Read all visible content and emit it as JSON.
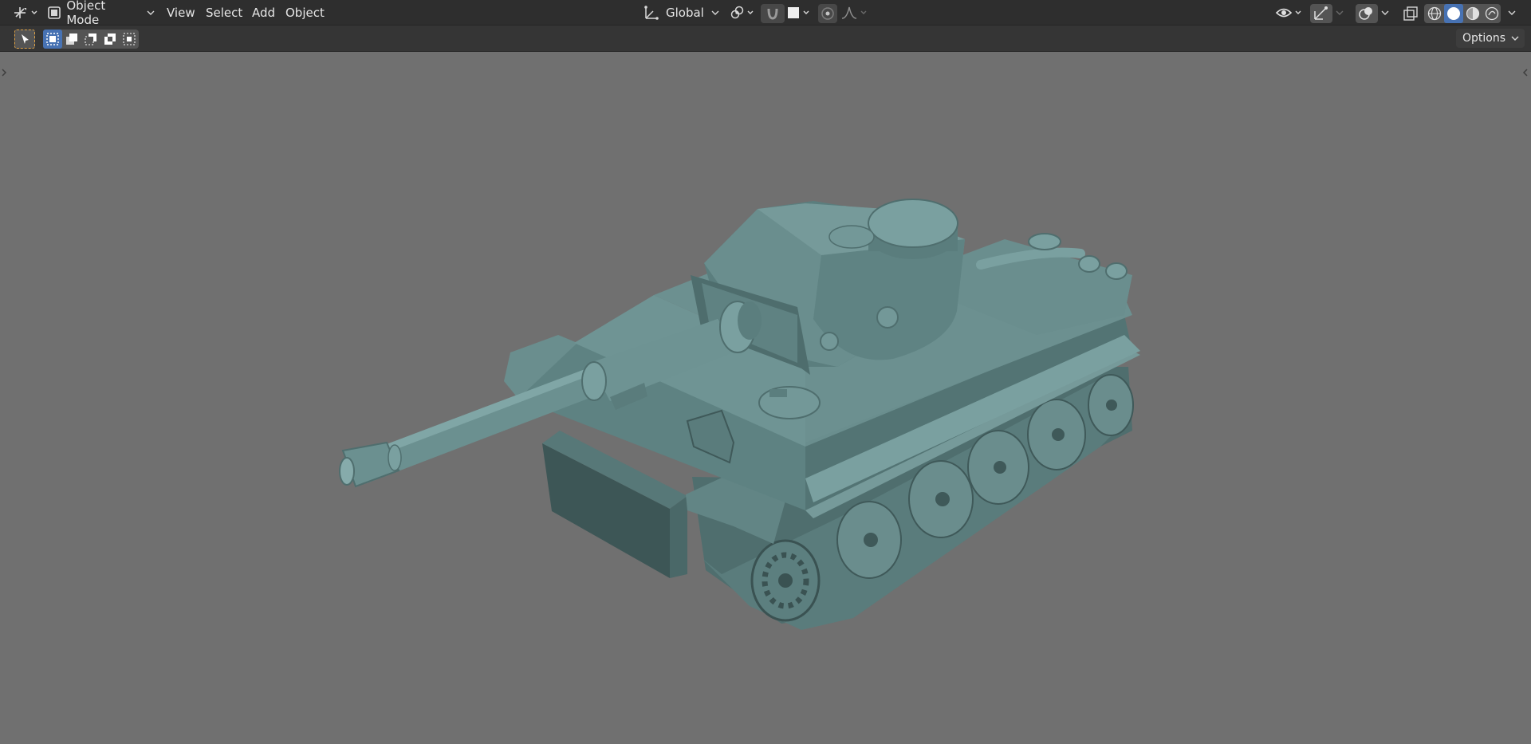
{
  "header": {
    "mode": "Object Mode",
    "menus": [
      "View",
      "Select",
      "Add",
      "Object"
    ],
    "transform_orientation": "Global"
  },
  "toolbar": {
    "options_label": "Options"
  },
  "icons": {
    "editor_type": "view3d-icon",
    "mode": "object-mode-icon",
    "orientation": "orientation-icon",
    "pivot": "pivot-icon",
    "snap": "magnet-icon",
    "proportional": "proportional-icon",
    "falloff": "falloff-curve-icon"
  },
  "viewport": {
    "background": "#707070",
    "model": "tank"
  },
  "colors": {
    "header_bg": "#2e2e2e",
    "toolbar_bg": "#353535",
    "viewport_bg": "#707070",
    "model_base": "#5f8282",
    "active_blue": "#4772b3",
    "active_orange": "#e0a245"
  }
}
